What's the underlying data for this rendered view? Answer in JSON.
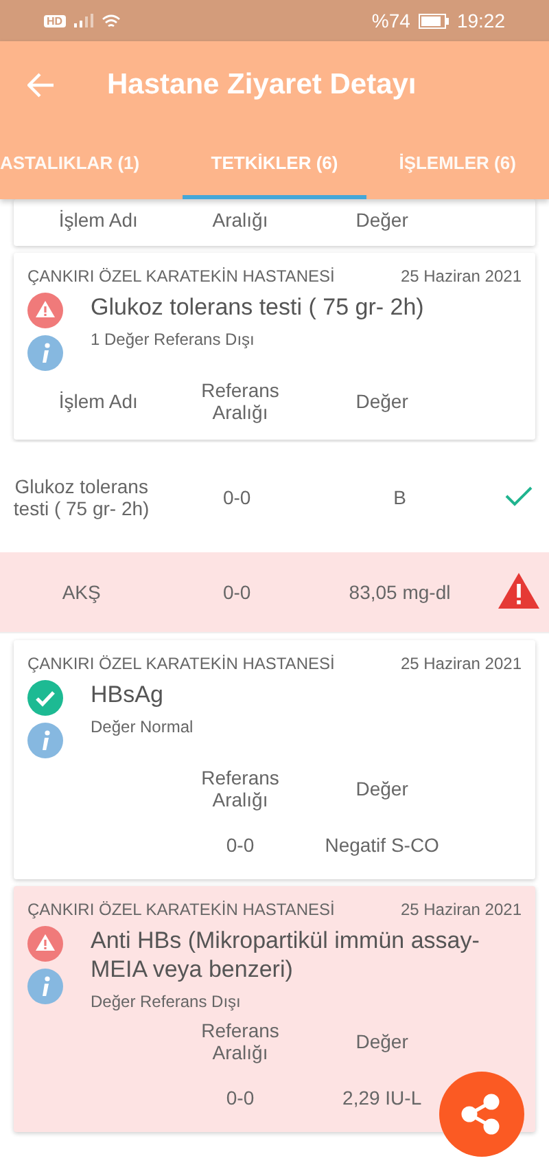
{
  "status_bar": {
    "network": "HD",
    "battery": "%74",
    "time": "19:22"
  },
  "app_bar": {
    "title": "Hastane Ziyaret Detayı"
  },
  "tabs": [
    {
      "label": "ASTALIKLAR (1)",
      "selected": false
    },
    {
      "label": "TETKİKLER (6)",
      "selected": true
    },
    {
      "label": "İŞLEMLER (6)",
      "selected": false
    }
  ],
  "partial_card": {
    "columns": {
      "name": "İşlem Adı",
      "range": "Aralığı",
      "value": "Değer"
    }
  },
  "tests": [
    {
      "hospital": "ÇANKIRI ÖZEL KARATEKİN HASTANESİ",
      "date": "25 Haziran 2021",
      "out_of_range": true,
      "highlighted": false,
      "name": "Glukoz tolerans testi ( 75 gr- 2h)",
      "note": "1 Değer Referans Dışı",
      "columns": {
        "name": "İşlem Adı",
        "range": "Referans Aralığı",
        "value": "Değer"
      },
      "rows_detached": true,
      "rows": [
        {
          "name": "Glukoz tolerans testi ( 75 gr- 2h)",
          "range": "0-0",
          "value": "B",
          "out_of_range": false
        },
        {
          "name": "AKŞ",
          "range": "0-0",
          "value": "83,05 mg-dl",
          "out_of_range": true
        }
      ]
    },
    {
      "hospital": "ÇANKIRI ÖZEL KARATEKİN HASTANESİ",
      "date": "25 Haziran 2021",
      "out_of_range": false,
      "highlighted": false,
      "name": "HBsAg",
      "note": "Değer Normal",
      "columns": {
        "range": "Referans Aralığı",
        "value": "Değer"
      },
      "rows_detached": false,
      "rows": [
        {
          "range": "0-0",
          "value": "Negatif S-CO"
        }
      ]
    },
    {
      "hospital": "ÇANKIRI ÖZEL KARATEKİN HASTANESİ",
      "date": "25 Haziran 2021",
      "out_of_range": true,
      "highlighted": true,
      "name": "Anti HBs  (Mikropartikül immün assay-MEIA veya benzeri)",
      "note": "Değer Referans Dışı",
      "columns": {
        "range": "Referans Aralığı",
        "value": "Değer"
      },
      "rows_detached": false,
      "rows": [
        {
          "range": "0-0",
          "value": "2,29 IU-L"
        }
      ]
    }
  ]
}
